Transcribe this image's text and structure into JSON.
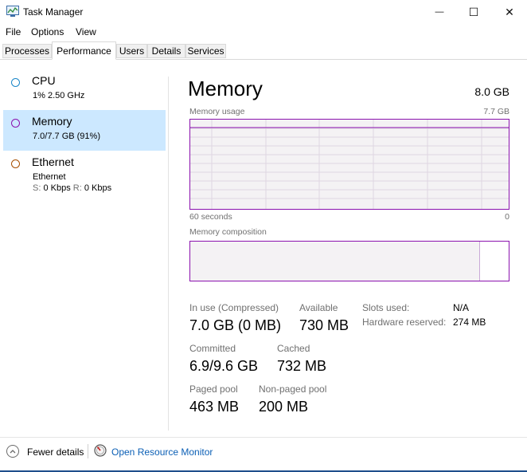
{
  "window": {
    "title": "Task Manager",
    "minimize": "—",
    "maximize": "☐",
    "close": "✕"
  },
  "menu": {
    "items": [
      "File",
      "Options",
      "View"
    ]
  },
  "tabs": [
    "Processes",
    "Performance",
    "Users",
    "Details",
    "Services"
  ],
  "active_tab": "Performance",
  "sidebar": {
    "items": [
      {
        "name": "CPU",
        "sub": "1%  2.50 GHz",
        "color": "#1a86c8"
      },
      {
        "name": "Memory",
        "sub": "7.0/7.7 GB (91%)",
        "color": "#8b12ae"
      },
      {
        "name": "Ethernet",
        "sub": "Ethernet",
        "s_label": "S:",
        "s_value": "0 Kbps",
        "r_label": "R:",
        "r_value": "0 Kbps",
        "color": "#a74f01"
      }
    ]
  },
  "memory": {
    "title": "Memory",
    "total": "8.0 GB",
    "usage_label": "Memory usage",
    "usage_max": "7.7 GB",
    "time_left": "60 seconds",
    "time_right": "0",
    "composition_label": "Memory composition",
    "composition_in_use_fraction": 0.91,
    "stats": {
      "in_use_label": "In use (Compressed)",
      "in_use_value": "7.0 GB (0 MB)",
      "available_label": "Available",
      "available_value": "730 MB",
      "committed_label": "Committed",
      "committed_value": "6.9/9.6 GB",
      "cached_label": "Cached",
      "cached_value": "732 MB",
      "paged_label": "Paged pool",
      "paged_value": "463 MB",
      "nonpaged_label": "Non-paged pool",
      "nonpaged_value": "200 MB"
    },
    "kv": {
      "slots_label": "Slots used:",
      "slots_value": "N/A",
      "hw_label": "Hardware reserved:",
      "hw_value": "274 MB"
    }
  },
  "footer": {
    "fewer_details": "Fewer details",
    "open_resource_monitor": "Open Resource Monitor"
  }
}
